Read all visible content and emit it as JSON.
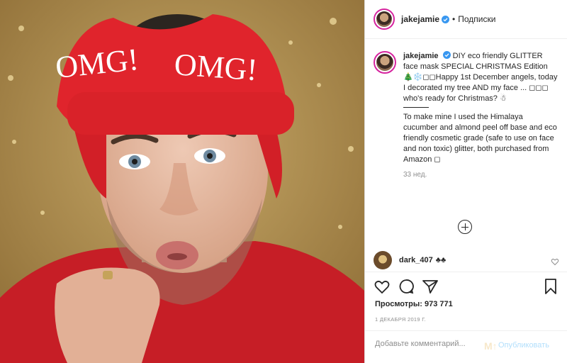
{
  "post": {
    "username": "jakejamie",
    "dot": "•",
    "following": "Подписки"
  },
  "caption": {
    "username": "jakejamie",
    "line1": "DIY eco friendly GLITTER face mask SPECIAL CHRISTMAS Edition 🎄❄️◻◻Happy 1st December angels, today I decorated my tree AND my face ... ◻◻◻ who's ready for Christmas? ☃",
    "line2": "To make mine I used the Himalaya cucumber and almond peel off base and eco friendly cosmetic grade (safe to use on face and non toxic) glitter, both purchased from Amazon ◻",
    "age": "33 нед."
  },
  "comment": {
    "username": "dark_407",
    "text": "♣♣"
  },
  "stats": {
    "views": "Просмотры: 973 771",
    "date": "1 ДЕКАБРЯ 2019 Г."
  },
  "add_comment": {
    "placeholder": "Добавьте комментарий...",
    "publish": "Опубликовать",
    "watermark": "M↑"
  },
  "media": {
    "headband_text": "OMG!"
  },
  "colors": {
    "ring": "#d6249f",
    "verified": "#3897f0",
    "publish": "#b2dffc",
    "headband": "#e0242c"
  },
  "icons": [
    "verified-icon",
    "add-icon",
    "heart-icon",
    "comment-icon",
    "share-icon",
    "bookmark-icon"
  ]
}
